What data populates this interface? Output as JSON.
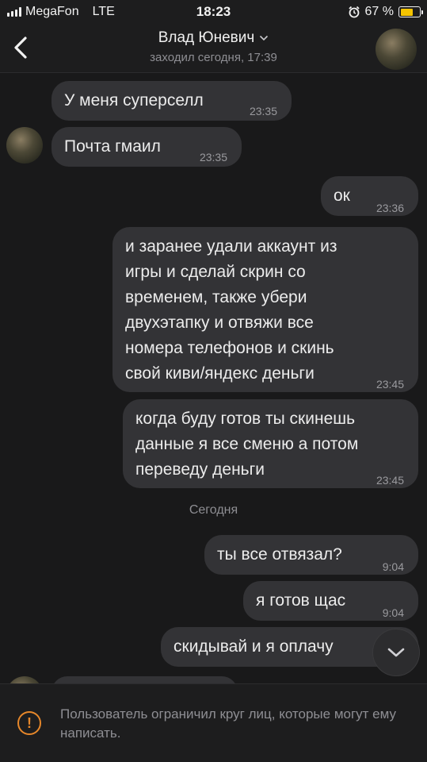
{
  "status_bar": {
    "carrier": "MegaFon",
    "network": "LTE",
    "time": "18:23",
    "battery": "67 %",
    "battery_level": 0.67,
    "battery_color": "#f5c400"
  },
  "header": {
    "back_icon": "chevron-left-icon",
    "contact_name": "Влад Юневич",
    "name_chevron_icon": "chevron-down-icon",
    "last_seen": "заходил сегодня, 17:39"
  },
  "messages": [
    {
      "text": "У меня суперселл",
      "time": "23:35",
      "from": "them"
    },
    {
      "text": "Почта гмаил",
      "time": "23:35",
      "from": "them"
    },
    {
      "text": "ок",
      "time": "23:36",
      "from": "me"
    },
    {
      "lines": [
        "и заранее удали аккаунт из",
        "игры и сделай скрин со",
        "временем, также убери",
        "двухэтапку и отвяжи все",
        "номера телефонов и скинь",
        "свой киви/яндекс деньги"
      ],
      "time": "23:45",
      "from": "me"
    },
    {
      "lines": [
        "когда буду готов ты скинешь",
        "данные я все сменю а потом",
        "переведу деньги"
      ],
      "time": "23:45",
      "from": "me"
    },
    {
      "text": "ты все отвязал?",
      "time": "9:04",
      "from": "me"
    },
    {
      "text": "я готов щас",
      "time": "9:04",
      "from": "me"
    },
    {
      "text": "скидывай и я оплачу",
      "time": "",
      "from": "me"
    }
  ],
  "day_separator": "Сегодня",
  "footer": {
    "warning_icon": "!",
    "notice": "Пользователь ограничил круг лиц, которые могут ему написать.",
    "accent": "#e6872a"
  }
}
